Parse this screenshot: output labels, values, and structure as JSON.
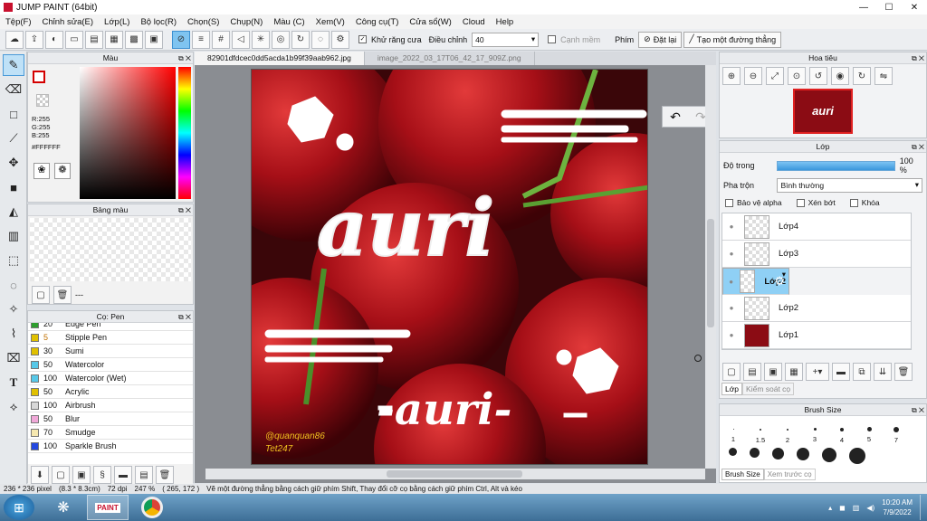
{
  "window": {
    "title": "JUMP PAINT (64bit)"
  },
  "menu": [
    "Tệp(F)",
    "Chỉnh sửa(E)",
    "Lớp(L)",
    "Bộ lọc(R)",
    "Chọn(S)",
    "Chụp(N)",
    "Màu (C)",
    "Xem(V)",
    "Công cụ(T)",
    "Cửa sổ(W)",
    "Cloud",
    "Help"
  ],
  "toolbar": {
    "antialias": "Khử răng cưa",
    "adjust_label": "Điều chỉnh",
    "adjust_value": "40",
    "smooth": "Cạnh mềm",
    "key_label": "Phím",
    "reset": "Đặt lại",
    "straight": "Tạo một đường thẳng"
  },
  "color_panel": {
    "title": "Màu",
    "r": "R:255",
    "g": "G:255",
    "b": "B:255",
    "hex": "#FFFFFF"
  },
  "palette_panel": {
    "title": "Bảng màu",
    "footer": "---"
  },
  "brush_panel": {
    "title": "Cọ: Pen",
    "items": [
      {
        "size": "20",
        "name": "Edge Pen",
        "color": "#2e9e2e"
      },
      {
        "size": "5",
        "name": "Stipple Pen",
        "color": "#e0c000"
      },
      {
        "size": "30",
        "name": "Sumi",
        "color": "#e0c000"
      },
      {
        "size": "50",
        "name": "Watercolor",
        "color": "#57c8e8"
      },
      {
        "size": "100",
        "name": "Watercolor (Wet)",
        "color": "#57c8e8"
      },
      {
        "size": "50",
        "name": "Acrylic",
        "color": "#e0c000"
      },
      {
        "size": "100",
        "name": "Airbrush",
        "color": "#d8d8d8"
      },
      {
        "size": "50",
        "name": "Blur",
        "color": "#f0a8d8"
      },
      {
        "size": "70",
        "name": "Smudge",
        "color": "#f6e8b0"
      },
      {
        "size": "100",
        "name": "Sparkle Brush",
        "color": "#2448e0"
      }
    ]
  },
  "tabs": [
    "82901dfdcec0dd5acda1b99f39aab962.jpg",
    "image_2022_03_17T06_42_17_909Z.png"
  ],
  "canvas": {
    "big_text": "auri",
    "small_text": "-auri-",
    "watermark1": "@quanquan86",
    "watermark2": "Tet247"
  },
  "navigator": {
    "title": "Hoa tiêu",
    "thumb_text": "auri"
  },
  "layer_panel": {
    "title": "Lớp",
    "opacity_label": "Độ trong",
    "opacity_value": "100 %",
    "opacity": 1.0,
    "blend_label": "Pha trộn",
    "blend_value": "Bình thường",
    "protect_alpha": "Bảo vệ alpha",
    "clip": "Xén bớt",
    "lock": "Khóa",
    "layers": [
      "Lớp4",
      "Lớp3",
      "Lớp2",
      "Lớp2",
      "Lớp1"
    ],
    "tab_layer": "Lớp",
    "tab_control": "Kiểm soát cọ"
  },
  "brush_size": {
    "title": "Brush Size",
    "sizes": [
      "1",
      "1.5",
      "2",
      "3",
      "4",
      "5",
      "7"
    ],
    "tab1": "Brush Size",
    "tab2": "Xem trước cọ"
  },
  "status": {
    "size": "236 * 236 pixel",
    "cm": "(8.3 * 8.3cm)",
    "dpi": "72 dpi",
    "zoom": "247 %",
    "coords": "( 265, 172 )",
    "hint": "Vẽ một đường thẳng bằng cách giữ phím Shift, Thay đổi cỡ cọ bằng cách giữ phím Ctrl, Alt và kéo"
  },
  "taskbar": {
    "time": "10:20 AM",
    "date": "7/9/2022",
    "paint_label": "PAINT"
  }
}
